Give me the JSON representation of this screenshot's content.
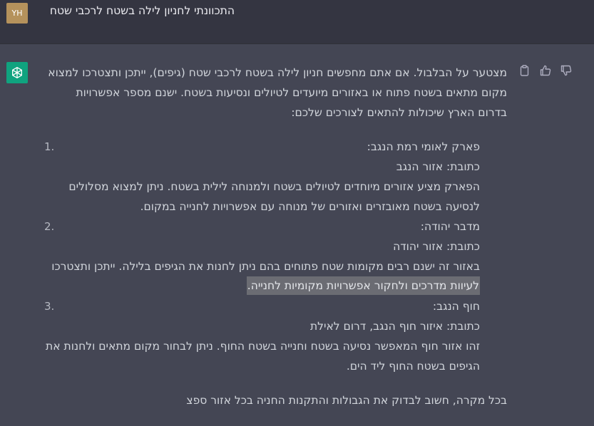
{
  "user": {
    "initials": "YH",
    "message": "התכוונתי לחניון לילה בשטח לרכבי שטח"
  },
  "assistant": {
    "intro": [
      "מצטער על הבלבול. אם אתם מחפשים חניון לילה בשטח לרכבי שטח (גיפים), ייתכן ותצטרכו למצוא",
      "מקום מתאים בשטח פתוח או באזורים מיועדים לטיולים ונסיעות בשטח. ישנם מספר אפשרויות",
      "בדרום הארץ שיכולות להתאים לצורכים שלכם:"
    ],
    "items": [
      {
        "number": "1.",
        "lines": [
          "פארק לאומי רמת הנגב:",
          "כתובת: אזור הנגב",
          "הפארק מציע אזורים מיוחדים לטיולים בשטח ולמנוחה לילית בשטח. ניתן למצוא מסלולים",
          "לנסיעה בשטח מאובזרים ואזורים של מנוחה עם אפשרויות לחנייה במקום."
        ]
      },
      {
        "number": "2.",
        "lines": [
          "מדבר יהודה:",
          "כתובת: אזור יהודה",
          "באזור זה ישנם רבים מקומות שטח פתוחים בהם ניתן לחנות את הגיפים בלילה. ייתכן ותצטרכו",
          "לעיוות מדרכים ולחקור אפשרויות מקומיות לחנייה."
        ]
      },
      {
        "number": "3.",
        "lines": [
          "חוף הנגב:",
          "כתובת: איזור חוף הנגב, דרום לאילת",
          "זהו אזור חוף המאפשר נסיעה בשטח וחנייה בשטח החוף. ניתן לבחור מקום מתאים ולחנות את",
          "הגיפים בשטח החוף ליד הים."
        ]
      }
    ],
    "closing": "בכל מקרה, חשוב לבדוק את הגבולות והתקנות החניה בכל אזור ספצ"
  },
  "icons": {
    "copy": "clipboard-icon",
    "like": "thumbs-up-icon",
    "dislike": "thumbs-down-icon",
    "logo": "openai-logo-icon"
  },
  "colors": {
    "user_bg": "#343541",
    "assistant_bg": "#444654",
    "avatar_user": "#b5925c",
    "avatar_gpt": "#10a37f"
  }
}
